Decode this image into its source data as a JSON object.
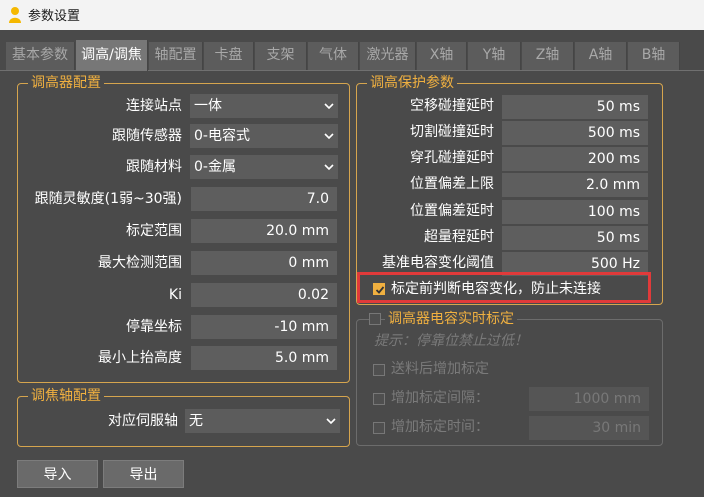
{
  "window": {
    "title": "参数设置"
  },
  "tabs": [
    "基本参数",
    "调高/调焦",
    "轴配置",
    "卡盘",
    "支架",
    "气体",
    "激光器",
    "X轴",
    "Y轴",
    "Z轴",
    "A轴",
    "B轴"
  ],
  "active_tab": "调高/调焦",
  "height_config": {
    "title": "调高器配置",
    "connect_site": {
      "label": "连接站点",
      "value": "一体"
    },
    "follow_sensor": {
      "label": "跟随传感器",
      "value": "0-电容式"
    },
    "follow_material": {
      "label": "跟随材料",
      "value": "0-金属"
    },
    "sensitivity": {
      "label": "跟随灵敏度(1弱~30强)",
      "value": "7.0"
    },
    "calib_range": {
      "label": "标定范围",
      "value": "20.0 mm"
    },
    "max_detect_range": {
      "label": "最大检测范围",
      "value": "0 mm"
    },
    "ki": {
      "label": "Ki",
      "value": "0.02"
    },
    "park_coord": {
      "label": "停靠坐标",
      "value": "-10 mm"
    },
    "min_lift": {
      "label": "最小上抬高度",
      "value": "5.0 mm"
    }
  },
  "focus_axis": {
    "title": "调焦轴配置",
    "servo_axis": {
      "label": "对应伺服轴",
      "value": "无"
    }
  },
  "protection": {
    "title": "调高保护参数",
    "idle_collision_delay": {
      "label": "空移碰撞延时",
      "value": "50 ms"
    },
    "cut_collision_delay": {
      "label": "切割碰撞延时",
      "value": "500 ms"
    },
    "pierce_collision_delay": {
      "label": "穿孔碰撞延时",
      "value": "200 ms"
    },
    "position_dev_limit": {
      "label": "位置偏差上限",
      "value": "2.0 mm"
    },
    "position_dev_delay": {
      "label": "位置偏差延时",
      "value": "100 ms"
    },
    "overrange_delay": {
      "label": "超量程延时",
      "value": "50 ms"
    },
    "cap_change_threshold": {
      "label": "基准电容变化阈值",
      "value": "500 Hz"
    },
    "check_before_calib": {
      "label": "标定前判断电容变化，防止未连接",
      "checked": true
    }
  },
  "realtime_calib": {
    "title": "调高器电容实时标定",
    "hint": "提示：停靠位禁止过低！",
    "after_feed": {
      "label": "送料后增加标定"
    },
    "add_interval": {
      "label": "增加标定间隔：",
      "value": "1000 mm"
    },
    "add_time": {
      "label": "增加标定时间：",
      "value": "30 min"
    }
  },
  "buttons": {
    "import": "导入",
    "export": "导出"
  },
  "colors": {
    "accent": "#f0b040",
    "highlight": "#e03a3a",
    "background": "#4a4a4a"
  }
}
